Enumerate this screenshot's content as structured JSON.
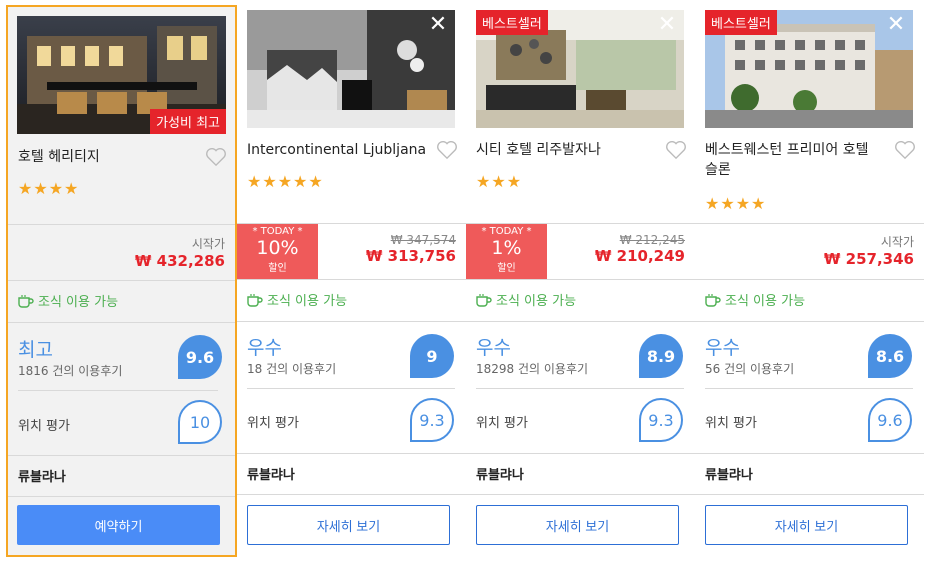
{
  "colors": {
    "accent_blue": "#4a90e2",
    "price_red": "#e5242b",
    "selected_border": "#f5a623",
    "breakfast_green": "#4caf50",
    "star": "#f5a623"
  },
  "hotels": [
    {
      "name": "호텔 헤리티지",
      "badge_top": "",
      "badge_bottom": "가성비 최고",
      "stars": "★★★★",
      "price_from_label": "시작가",
      "original_price": "",
      "price": "₩ 432,286",
      "today_label": "",
      "today_pct": "",
      "today_sub": "",
      "breakfast": "조식 이용 가능",
      "rating_word": "최고",
      "review_count": "1816 건의 이용후기",
      "score": "9.6",
      "location_label": "위치 평가",
      "location_score": "10",
      "city": "류블랴나",
      "button": "예약하기",
      "close_icon": ""
    },
    {
      "name": "Intercontinental Ljubljana",
      "badge_top": "",
      "badge_bottom": "",
      "stars": "★★★★★",
      "price_from_label": "",
      "original_price": "₩ 347,574",
      "price": "₩ 313,756",
      "today_label": "* TODAY *",
      "today_pct": "10%",
      "today_sub": "할인",
      "breakfast": "조식 이용 가능",
      "rating_word": "우수",
      "review_count": "18 건의 이용후기",
      "score": "9",
      "location_label": "위치 평가",
      "location_score": "9.3",
      "city": "류블랴나",
      "button": "자세히 보기",
      "close_icon": "✕"
    },
    {
      "name": "시티 호텔 리주발자나",
      "badge_top": "베스트셀러",
      "badge_bottom": "",
      "stars": "★★★",
      "price_from_label": "",
      "original_price": "₩ 212,245",
      "price": "₩ 210,249",
      "today_label": "* TODAY *",
      "today_pct": "1%",
      "today_sub": "할인",
      "breakfast": "조식 이용 가능",
      "rating_word": "우수",
      "review_count": "18298 건의 이용후기",
      "score": "8.9",
      "location_label": "위치 평가",
      "location_score": "9.3",
      "city": "류블랴나",
      "button": "자세히 보기",
      "close_icon": "✕"
    },
    {
      "name": "베스트웨스턴 프리미어 호텔 슬론",
      "badge_top": "베스트셀러",
      "badge_bottom": "",
      "stars": "★★★★",
      "price_from_label": "시작가",
      "original_price": "",
      "price": "₩ 257,346",
      "today_label": "",
      "today_pct": "",
      "today_sub": "",
      "breakfast": "조식 이용 가능",
      "rating_word": "우수",
      "review_count": "56 건의 이용후기",
      "score": "8.6",
      "location_label": "위치 평가",
      "location_score": "9.6",
      "city": "류블랴나",
      "button": "자세히 보기",
      "close_icon": "✕"
    }
  ]
}
